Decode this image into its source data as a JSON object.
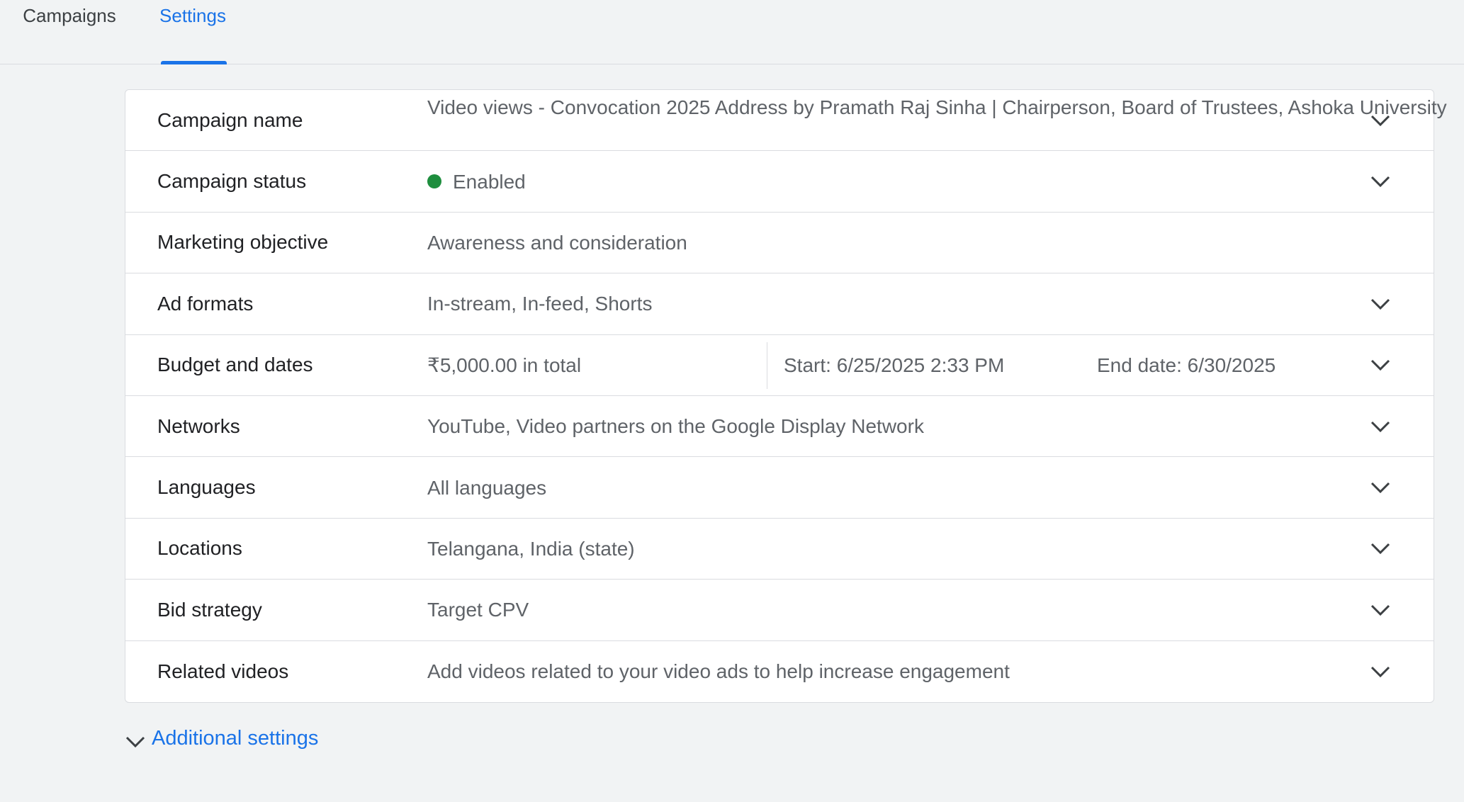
{
  "tabs": [
    {
      "label": "Campaigns",
      "active": false
    },
    {
      "label": "Settings",
      "active": true
    }
  ],
  "settings": {
    "rows": [
      {
        "label": "Campaign name",
        "value": "Video views - Convocation 2025 Address by Pramath Raj Sinha | Chairperson, Board of Trustees, Ashoka University",
        "expandable": true
      },
      {
        "label": "Campaign status",
        "value": "Enabled",
        "expandable": true
      },
      {
        "label": "Marketing objective",
        "value": "Awareness and consideration",
        "expandable": false
      },
      {
        "label": "Ad formats",
        "value": "In-stream, In-feed, Shorts",
        "expandable": true
      },
      {
        "label": "Budget and dates",
        "budget": "₹5,000.00 in total",
        "start": "Start: 6/25/2025 2:33 PM",
        "end": "End date: 6/30/2025",
        "expandable": true
      },
      {
        "label": "Networks",
        "value": "YouTube, Video partners on the Google Display Network",
        "expandable": true
      },
      {
        "label": "Languages",
        "value": "All languages",
        "expandable": true
      },
      {
        "label": "Locations",
        "value": "Telangana, India (state)",
        "expandable": true
      },
      {
        "label": "Bid strategy",
        "value": "Target CPV",
        "expandable": true
      },
      {
        "label": "Related videos",
        "value": "Add videos related to your video ads to help increase engagement",
        "expandable": true
      }
    ]
  },
  "additional_settings": {
    "label": "Additional settings",
    "icon": "chevron-down-icon"
  },
  "colors": {
    "accent": "#1a73e8",
    "status_enabled": "#1e8e3e",
    "background": "#f1f3f4",
    "card": "#ffffff",
    "border": "#dadce0"
  },
  "icons": {
    "row_expand": "chevron-down-icon",
    "status": "status-dot-icon"
  }
}
